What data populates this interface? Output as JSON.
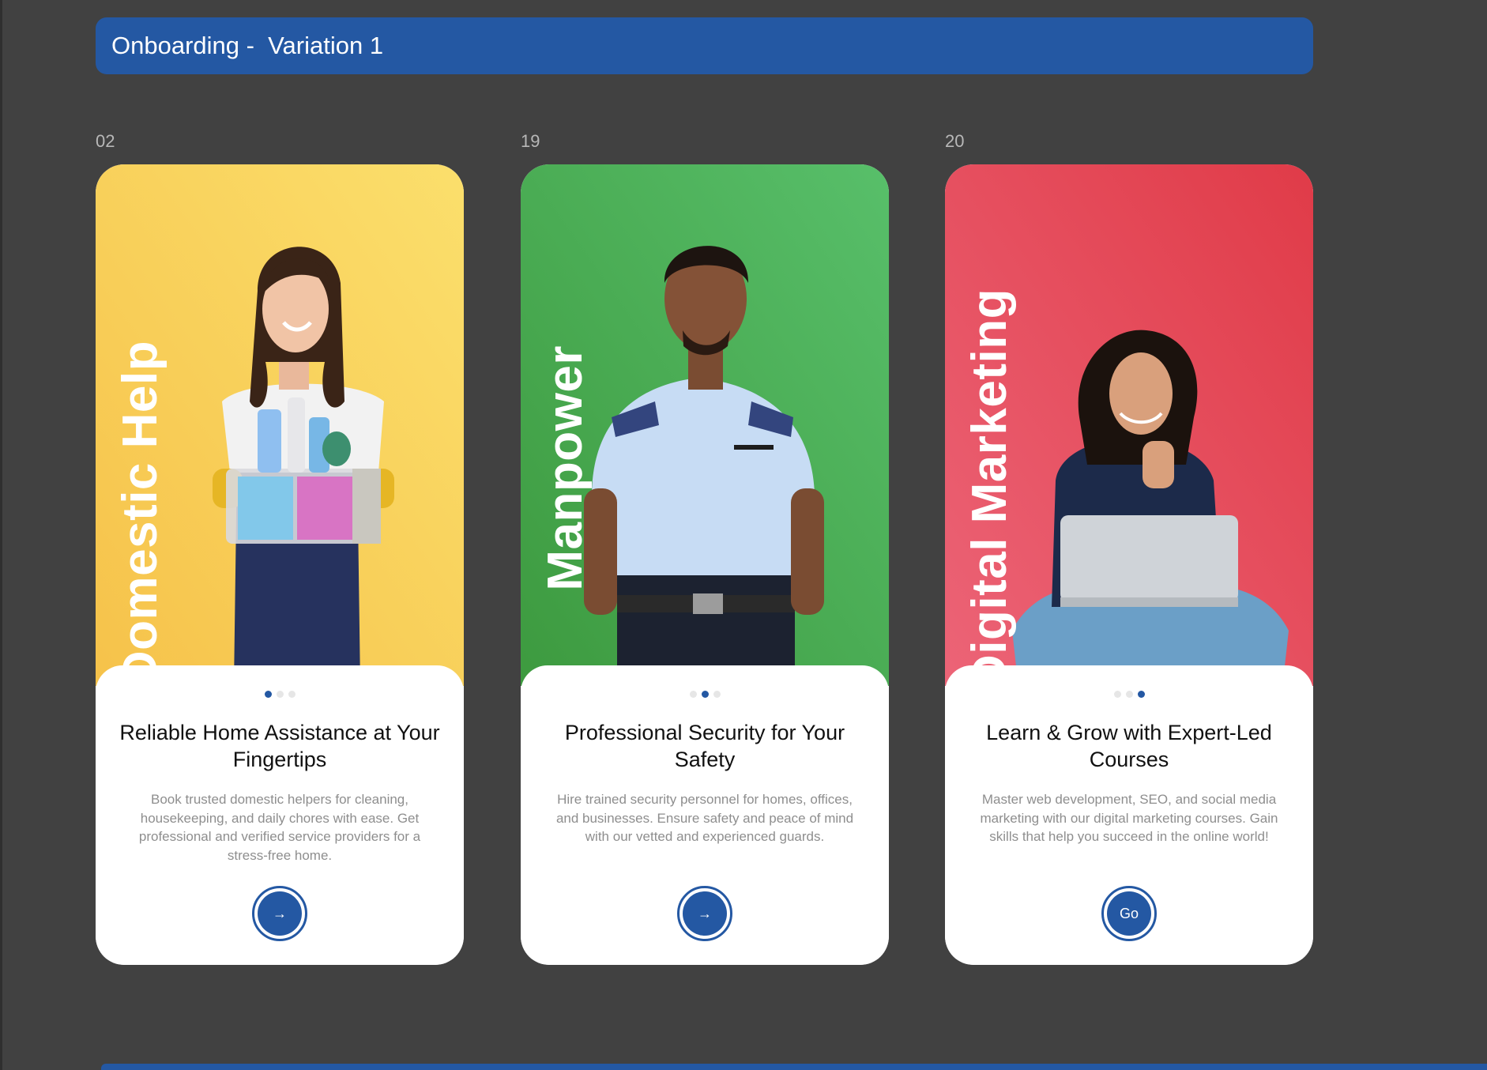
{
  "header": {
    "title": "Onboarding -  Variation 1"
  },
  "colors": {
    "brand": "#2458a3",
    "background": "#414141"
  },
  "cards": [
    {
      "frame_number": "02",
      "vertical_title": "Domestic Help",
      "theme": "yellow",
      "headline": "Reliable Home Assistance at Your Fingertips",
      "description": "Book trusted domestic helpers for cleaning, housekeeping, and daily chores with ease. Get professional and verified service providers for a stress-free home.",
      "active_dot": 1,
      "cta_label": "→",
      "cta_icon": "arrow-right-icon",
      "image": "woman-with-cleaning-supplies"
    },
    {
      "frame_number": "19",
      "vertical_title": "Manpower",
      "theme": "green",
      "headline": "Professional Security for Your Safety",
      "description": "Hire trained security personnel for homes, offices, and businesses. Ensure safety and peace of mind with our vetted and experienced guards.",
      "active_dot": 2,
      "cta_label": "→",
      "cta_icon": "arrow-right-icon",
      "image": "security-guard-in-uniform"
    },
    {
      "frame_number": "20",
      "vertical_title": "Digital Marketing",
      "theme": "red",
      "headline": "Learn & Grow with Expert-Led Courses",
      "description": "Master web development, SEO, and social media marketing with our digital marketing courses. Gain skills that help you succeed in the online world!",
      "active_dot": 3,
      "cta_label": "Go",
      "cta_icon": "",
      "image": "woman-with-laptop-thumbs-up"
    }
  ]
}
